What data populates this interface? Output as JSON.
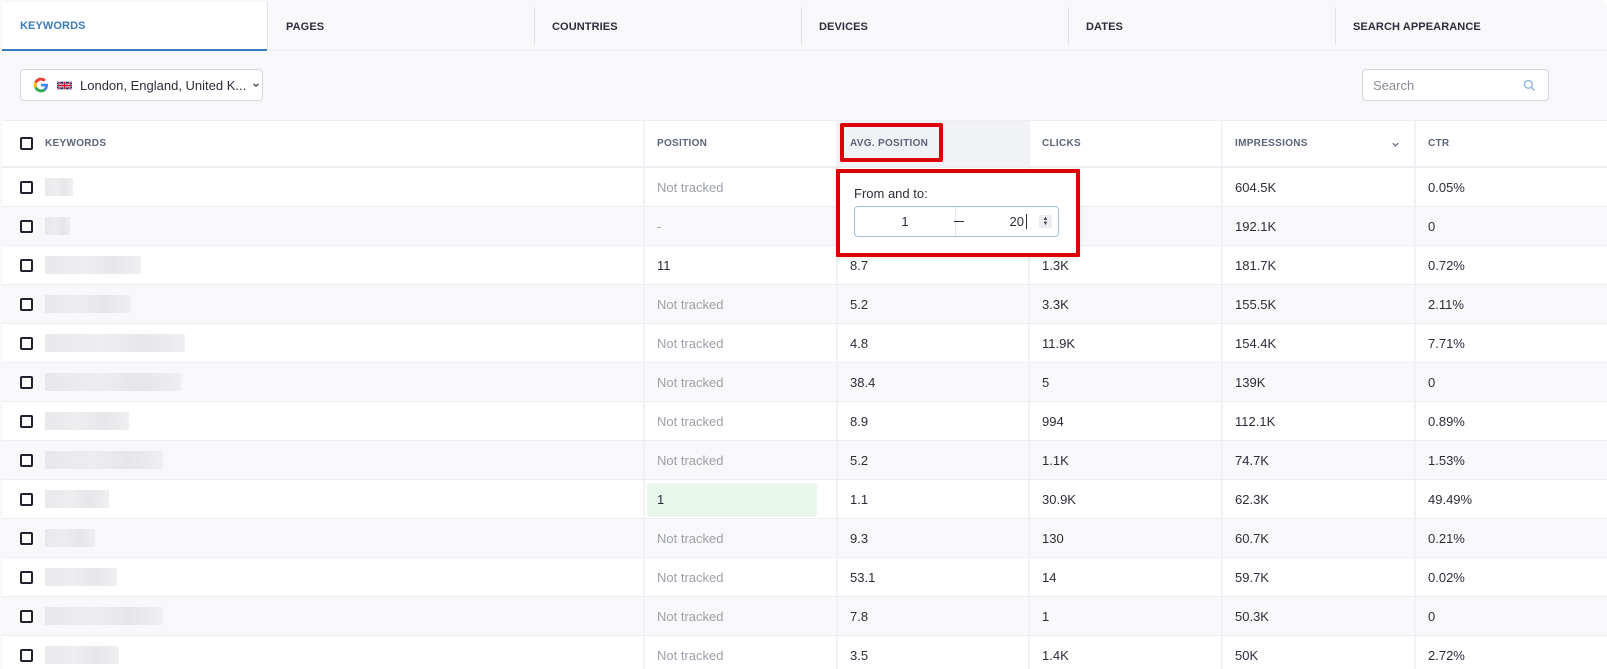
{
  "tabs": [
    {
      "label": "KEYWORDS",
      "active": true
    },
    {
      "label": "PAGES"
    },
    {
      "label": "COUNTRIES"
    },
    {
      "label": "DEVICES"
    },
    {
      "label": "DATES"
    },
    {
      "label": "SEARCH APPEARANCE"
    }
  ],
  "toolbar": {
    "location_label": "London, England, United K...",
    "search_placeholder": "Search",
    "search_value": ""
  },
  "table": {
    "columns": [
      "KEYWORDS",
      "POSITION",
      "AVG. POSITION",
      "CLICKS",
      "IMPRESSIONS",
      "CTR"
    ],
    "sorted_column": "IMPRESSIONS",
    "rows": [
      {
        "keyword": "",
        "position": "Not tracked",
        "avg_position": "",
        "clicks": "",
        "impressions": "604.5K",
        "ctr": "0.05%"
      },
      {
        "keyword": "",
        "position": "-",
        "avg_position": "",
        "clicks": "",
        "impressions": "192.1K",
        "ctr": "0"
      },
      {
        "keyword": "",
        "position": "11",
        "avg_position": "8.7",
        "clicks": "1.3K",
        "impressions": "181.7K",
        "ctr": "0.72%"
      },
      {
        "keyword": "",
        "position": "Not tracked",
        "avg_position": "5.2",
        "clicks": "3.3K",
        "impressions": "155.5K",
        "ctr": "2.11%"
      },
      {
        "keyword": "",
        "position": "Not tracked",
        "avg_position": "4.8",
        "clicks": "11.9K",
        "impressions": "154.4K",
        "ctr": "7.71%"
      },
      {
        "keyword": "",
        "position": "Not tracked",
        "avg_position": "38.4",
        "clicks": "5",
        "impressions": "139K",
        "ctr": "0"
      },
      {
        "keyword": "",
        "position": "Not tracked",
        "avg_position": "8.9",
        "clicks": "994",
        "impressions": "112.1K",
        "ctr": "0.89%"
      },
      {
        "keyword": "",
        "position": "Not tracked",
        "avg_position": "5.2",
        "clicks": "1.1K",
        "impressions": "74.7K",
        "ctr": "1.53%"
      },
      {
        "keyword": "",
        "position": "1",
        "avg_position": "1.1",
        "clicks": "30.9K",
        "impressions": "62.3K",
        "ctr": "49.49%",
        "highlight": true
      },
      {
        "keyword": "",
        "position": "Not tracked",
        "avg_position": "9.3",
        "clicks": "130",
        "impressions": "60.7K",
        "ctr": "0.21%"
      },
      {
        "keyword": "",
        "position": "Not tracked",
        "avg_position": "53.1",
        "clicks": "14",
        "impressions": "59.7K",
        "ctr": "0.02%"
      },
      {
        "keyword": "",
        "position": "Not tracked",
        "avg_position": "7.8",
        "clicks": "1",
        "impressions": "50.3K",
        "ctr": "0"
      },
      {
        "keyword": "",
        "position": "Not tracked",
        "avg_position": "3.5",
        "clicks": "1.4K",
        "impressions": "50K",
        "ctr": "2.72%"
      }
    ]
  },
  "filter_popup": {
    "label": "From and to:",
    "from_value": "1",
    "to_value": "20"
  },
  "colors": {
    "accent": "#3a7bbd",
    "highlight_red": "#dd0000",
    "position_top_bg": "#e8f7ec",
    "muted_text": "#9da0aa"
  }
}
